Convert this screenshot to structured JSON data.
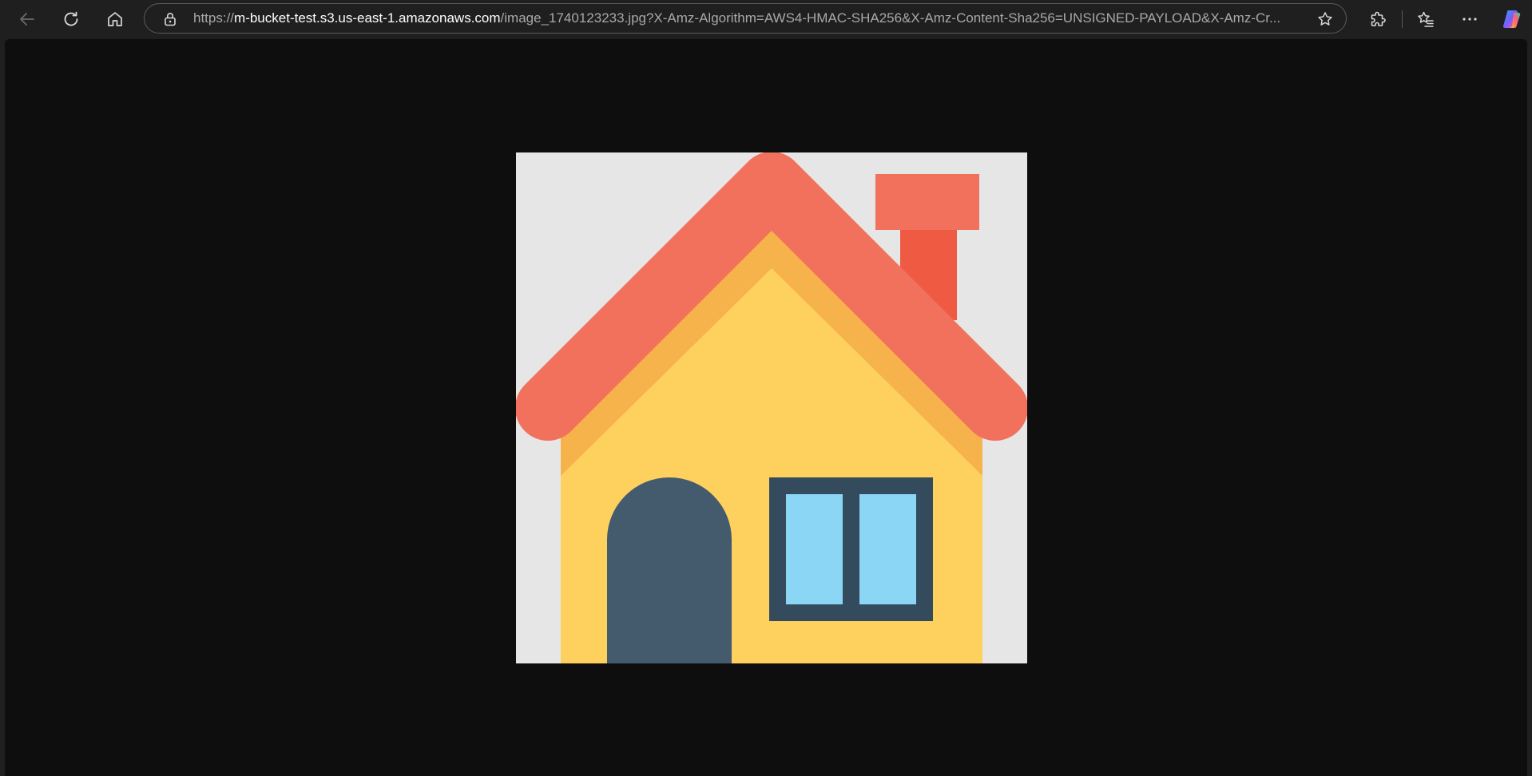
{
  "browser": {
    "address_bar": {
      "url_scheme": "https://",
      "url_host": "m-bucket-test.s3.us-east-1.amazonaws.com",
      "url_rest": "/image_1740123233.jpg?X-Amz-Algorithm=AWS4-HMAC-SHA256&X-Amz-Content-Sha256=UNSIGNED-PAYLOAD&X-Amz-Cr..."
    },
    "icons": {
      "back": "arrow-left",
      "refresh": "refresh",
      "home": "home",
      "site_info": "lock",
      "favorite": "star-outline",
      "extensions": "puzzle",
      "favorites": "star-list",
      "more": "ellipsis",
      "copilot": "copilot"
    }
  },
  "content": {
    "image_subject": "house-illustration"
  },
  "colors": {
    "background": "#e6e6e6",
    "roof": "#f2715c",
    "chimney_top": "#f2715c",
    "chimney_body": "#ee5a42",
    "roof_underside": "#f6b24b",
    "walls": "#fed05e",
    "door": "#445b6e",
    "window_frame": "#344b5e",
    "window_glass": "#8bd6f5"
  }
}
